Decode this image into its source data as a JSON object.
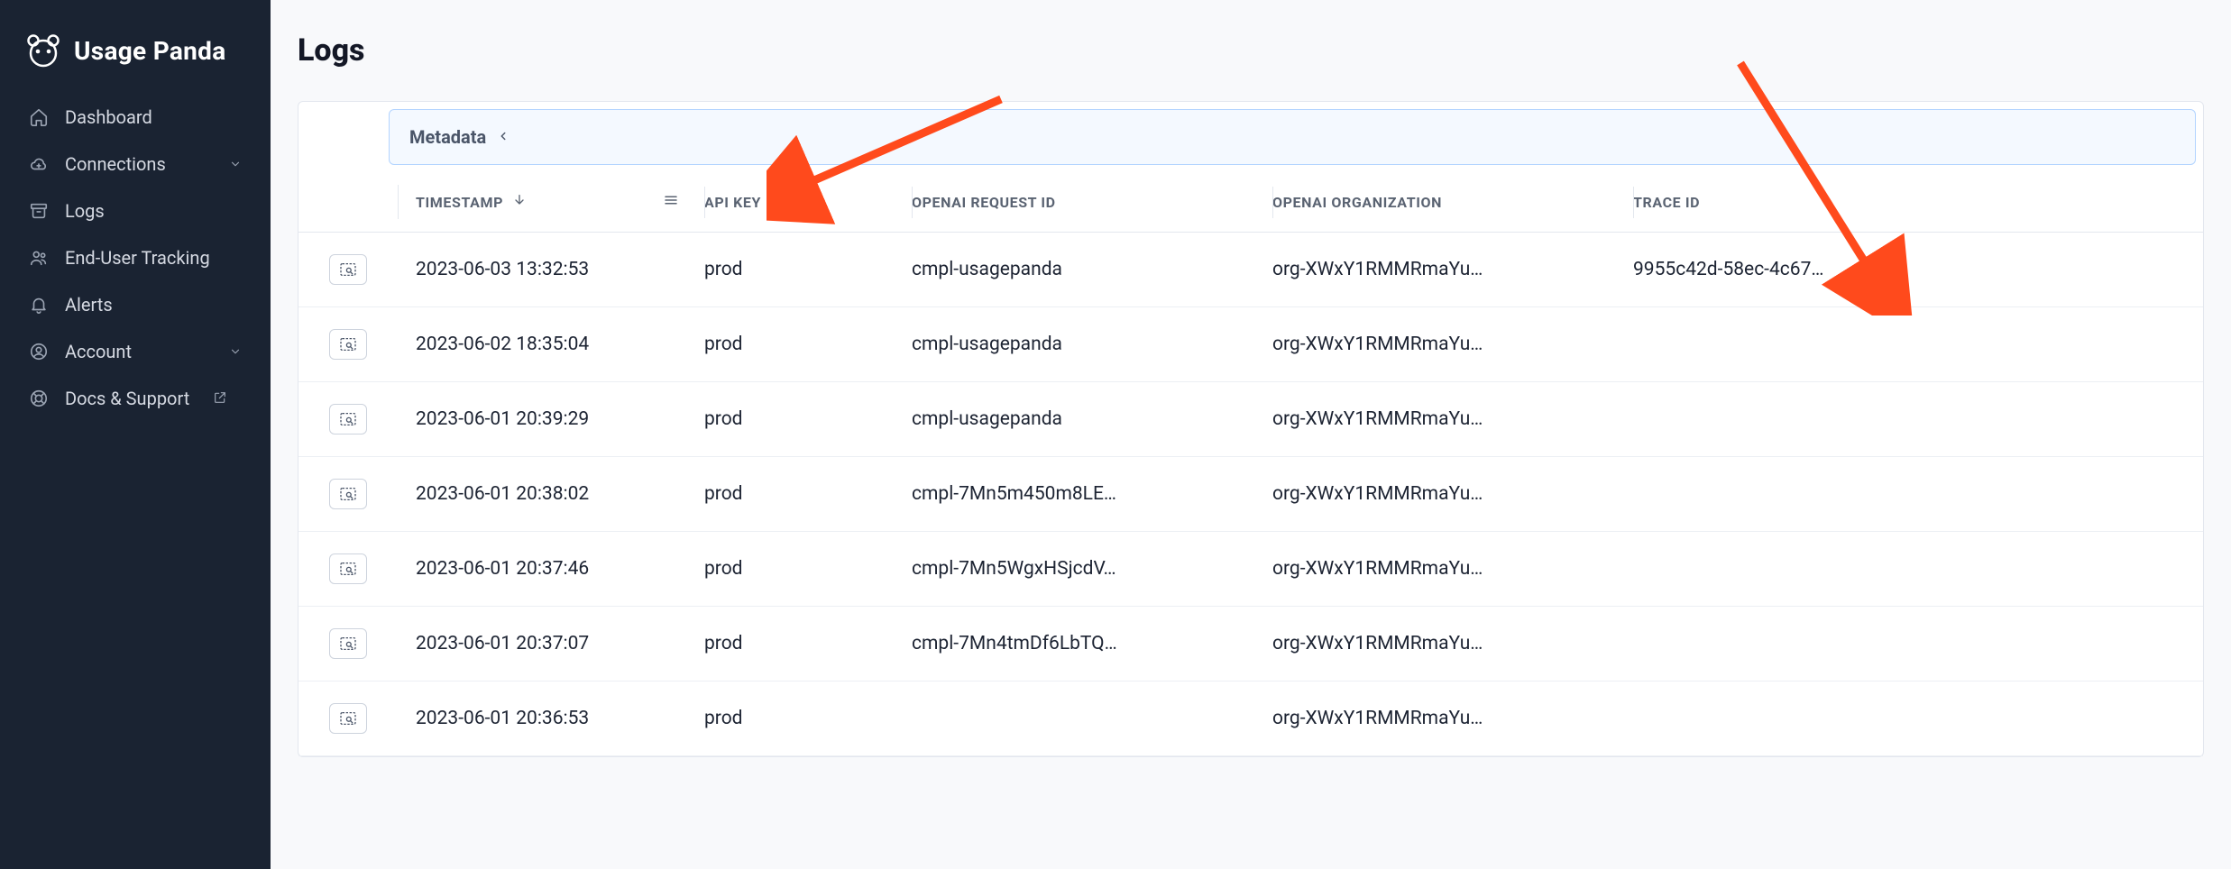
{
  "brand": {
    "name": "Usage Panda"
  },
  "sidebar": {
    "items": [
      {
        "label": "Dashboard",
        "icon": "home-icon",
        "chevron": false,
        "ext": false
      },
      {
        "label": "Connections",
        "icon": "cloud-icon",
        "chevron": true,
        "ext": false
      },
      {
        "label": "Logs",
        "icon": "archive-icon",
        "chevron": false,
        "ext": false
      },
      {
        "label": "End-User Tracking",
        "icon": "users-icon",
        "chevron": false,
        "ext": false
      },
      {
        "label": "Alerts",
        "icon": "bell-icon",
        "chevron": false,
        "ext": false
      },
      {
        "label": "Account",
        "icon": "user-circle-icon",
        "chevron": true,
        "ext": false
      },
      {
        "label": "Docs & Support",
        "icon": "life-ring-icon",
        "chevron": false,
        "ext": true
      }
    ]
  },
  "page": {
    "title": "Logs"
  },
  "metadata_bar": {
    "label": "Metadata"
  },
  "table": {
    "columns": {
      "timestamp": "TIMESTAMP",
      "api_key": "API KEY",
      "request_id": "OPENAI REQUEST ID",
      "organization": "OPENAI ORGANIZATION",
      "trace_id": "TRACE ID"
    },
    "rows": [
      {
        "timestamp": "2023-06-03 13:32:53",
        "api_key": "prod",
        "request_id": "cmpl-usagepanda",
        "organization": "org-XWxY1RMMRmaYu…",
        "trace_id": "9955c42d-58ec-4c67…"
      },
      {
        "timestamp": "2023-06-02 18:35:04",
        "api_key": "prod",
        "request_id": "cmpl-usagepanda",
        "organization": "org-XWxY1RMMRmaYu…",
        "trace_id": ""
      },
      {
        "timestamp": "2023-06-01 20:39:29",
        "api_key": "prod",
        "request_id": "cmpl-usagepanda",
        "organization": "org-XWxY1RMMRmaYu…",
        "trace_id": ""
      },
      {
        "timestamp": "2023-06-01 20:38:02",
        "api_key": "prod",
        "request_id": "cmpl-7Mn5m450m8LE…",
        "organization": "org-XWxY1RMMRmaYu…",
        "trace_id": ""
      },
      {
        "timestamp": "2023-06-01 20:37:46",
        "api_key": "prod",
        "request_id": "cmpl-7Mn5WgxHSjcdV…",
        "organization": "org-XWxY1RMMRmaYu…",
        "trace_id": ""
      },
      {
        "timestamp": "2023-06-01 20:37:07",
        "api_key": "prod",
        "request_id": "cmpl-7Mn4tmDf6LbTQ…",
        "organization": "org-XWxY1RMMRmaYu…",
        "trace_id": ""
      },
      {
        "timestamp": "2023-06-01 20:36:53",
        "api_key": "prod",
        "request_id": "",
        "organization": "org-XWxY1RMMRmaYu…",
        "trace_id": ""
      }
    ]
  },
  "annotations": {
    "arrow_color": "#ff4a1c"
  }
}
